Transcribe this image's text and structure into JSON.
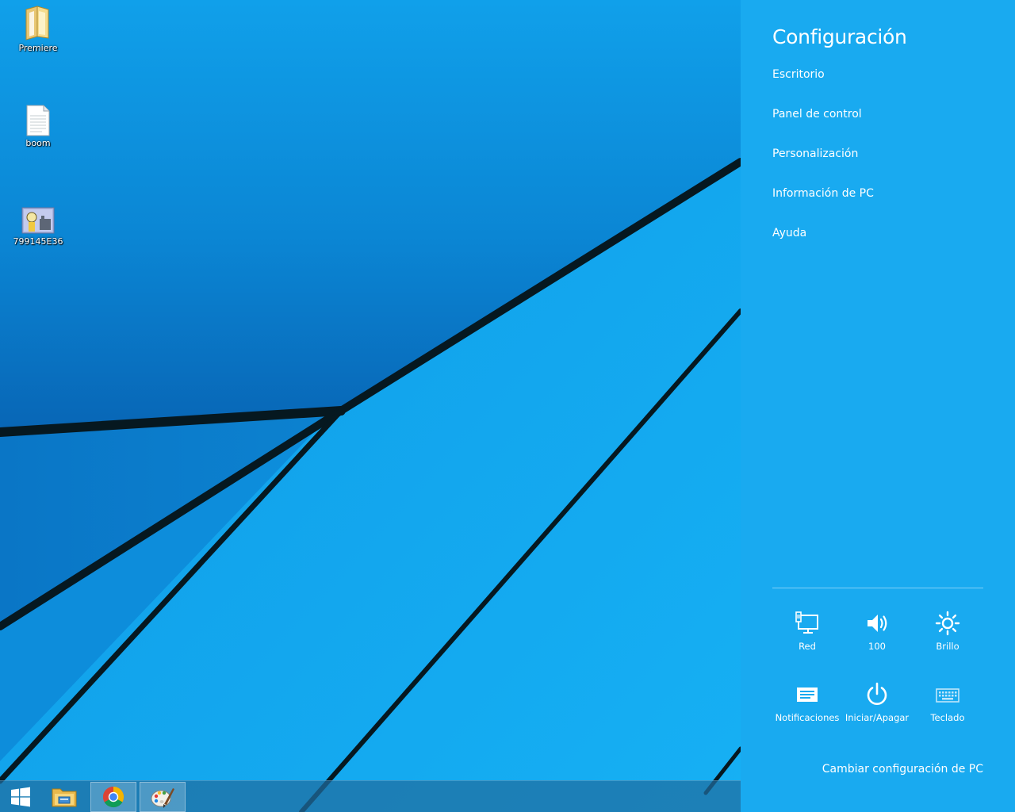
{
  "desktop": {
    "icons": [
      {
        "label": "Premiere",
        "icon": "folder-icon"
      },
      {
        "label": "boom",
        "icon": "text-file-icon"
      },
      {
        "label": "799145E36",
        "icon": "image-file-icon"
      }
    ]
  },
  "taskbar": {
    "buttons": [
      {
        "icon": "windows-start-icon"
      },
      {
        "icon": "file-explorer-icon"
      },
      {
        "icon": "chrome-icon"
      },
      {
        "icon": "paint-icon"
      }
    ]
  },
  "settings_charm": {
    "title": "Configuración",
    "links": [
      "Escritorio",
      "Panel de control",
      "Personalización",
      "Información de PC",
      "Ayuda"
    ],
    "quick_settings": [
      {
        "label": "Red",
        "icon": "network-icon"
      },
      {
        "label": "100",
        "icon": "volume-icon"
      },
      {
        "label": "Brillo",
        "icon": "brightness-icon"
      },
      {
        "label": "Notificaciones",
        "icon": "notifications-icon"
      },
      {
        "label": "Iniciar/Apagar",
        "icon": "power-icon"
      },
      {
        "label": "Teclado",
        "icon": "keyboard-icon"
      }
    ],
    "change_pc_settings": "Cambiar configuración de PC"
  },
  "colors": {
    "charm_background": "#19aaf0",
    "wallpaper_light": "#12a6ec",
    "wallpaper_dark": "#0664b4",
    "wallpaper_line": "#06141c"
  }
}
